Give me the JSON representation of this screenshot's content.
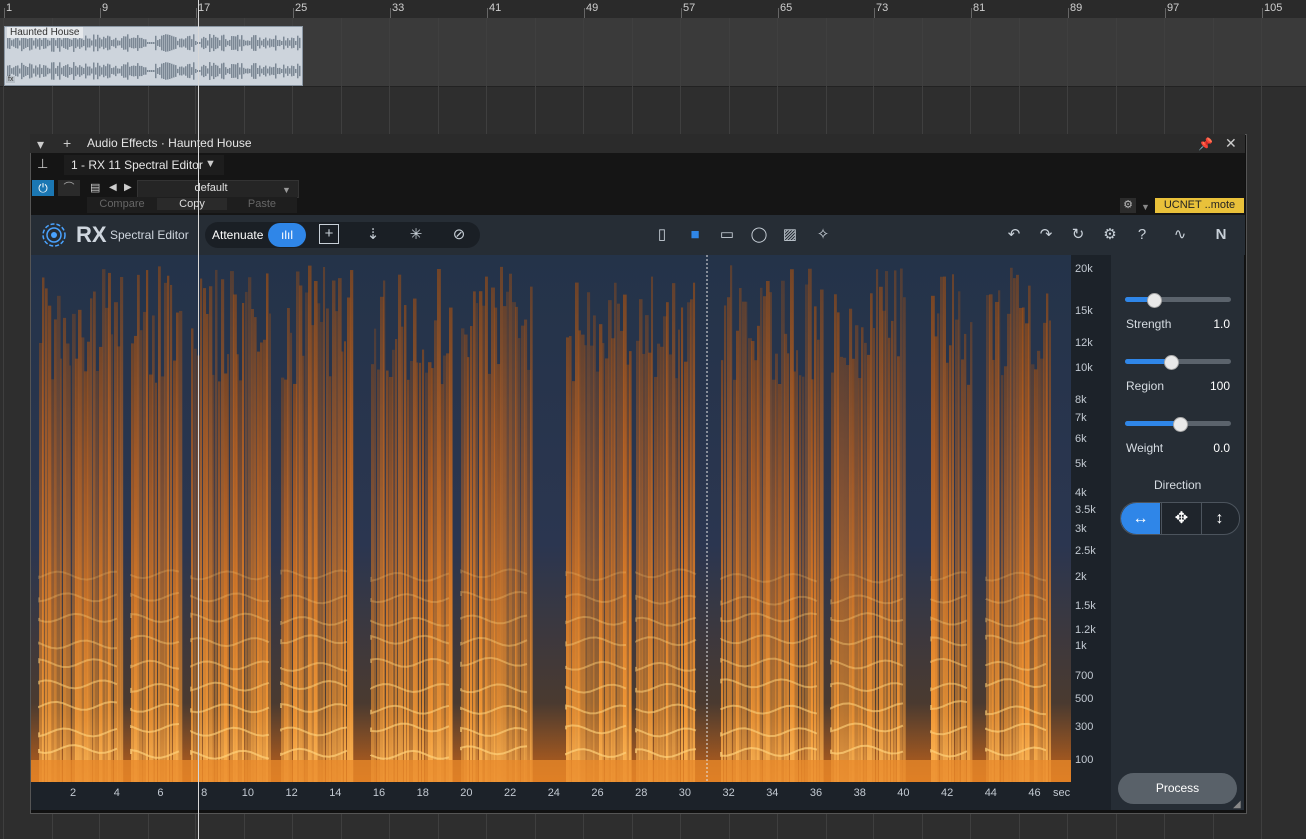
{
  "timeline": {
    "bar_numbers": [
      "1",
      "9",
      "17",
      "25",
      "33",
      "41",
      "49",
      "57",
      "65",
      "73",
      "81",
      "89",
      "97",
      "105"
    ],
    "clip_name": "Haunted House",
    "clip_fx_badge": "fx"
  },
  "window": {
    "title": "Audio Effects · Haunted House",
    "plugin_slot": "1 - RX 11 Spectral Editor",
    "preset_name": "default",
    "compare_label": "Compare",
    "copy_label": "Copy",
    "paste_label": "Paste",
    "remote_label": "UCNET ..mote"
  },
  "rx": {
    "logo": "RX",
    "module_name": "Spectral Editor",
    "mode_label": "Attenuate"
  },
  "freq_labels": [
    "20k",
    "15k",
    "12k",
    "10k",
    "8k",
    "7k",
    "6k",
    "5k",
    "4k",
    "3.5k",
    "3k",
    "2.5k",
    "2k",
    "1.5k",
    "1.2k",
    "1k",
    "700",
    "500",
    "300",
    "100"
  ],
  "time_labels": [
    "2",
    "4",
    "6",
    "8",
    "10",
    "12",
    "14",
    "16",
    "18",
    "20",
    "22",
    "24",
    "26",
    "28",
    "30",
    "32",
    "34",
    "36",
    "38",
    "40",
    "42",
    "44",
    "46"
  ],
  "time_unit": "sec",
  "panel": {
    "strength": {
      "label": "Strength",
      "value": "1.0",
      "level": 0.27
    },
    "region": {
      "label": "Region",
      "value": "100",
      "level": 0.43
    },
    "weight": {
      "label": "Weight",
      "value": "0.0",
      "level": 0.52
    },
    "direction_label": "Direction",
    "direction_selected": "horizontal",
    "process_label": "Process"
  },
  "colors": {
    "accent": "#2f86e8",
    "remote": "#e9c13a",
    "spectro_hot": "#ff9a30",
    "spectro_cold": "#1f2c45"
  }
}
